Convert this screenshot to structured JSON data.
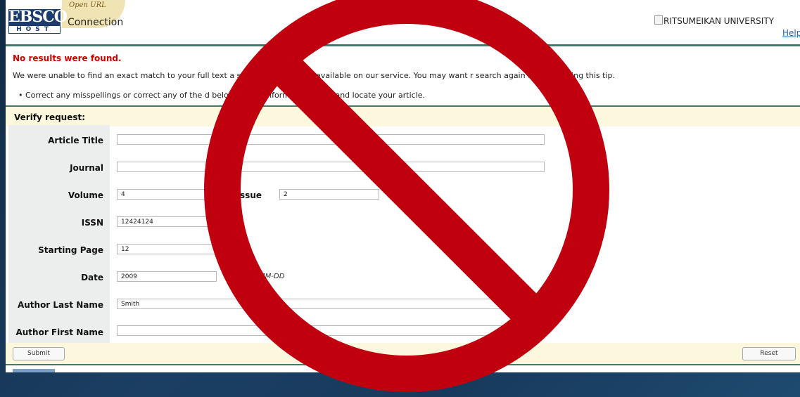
{
  "header": {
    "brand_top": "EBSCO",
    "brand_bottom": "HOST",
    "tagline": "Open URL",
    "product": "Connection",
    "institution_logo_alt": "RITSUMEIKAN UNIVERSITY",
    "help_link": "Help"
  },
  "messages": {
    "error": "No results were found.",
    "explanation": "We were unable to find an exact match to your full text a                   s p              article is not yet available on our service. You may want                 r search again after following this tip.",
    "tip": "Correct any misspellings or correct any of the d              below an                    the information to try and locate your article."
  },
  "form": {
    "title": "Verify request:",
    "fields": {
      "article_title": {
        "label": "Article Title",
        "value": ""
      },
      "journal": {
        "label": "Journal",
        "value": ""
      },
      "volume": {
        "label": "Volume",
        "value": "4"
      },
      "issue": {
        "label": "Issue",
        "value": "2"
      },
      "issn": {
        "label": "ISSN",
        "value": "12424124"
      },
      "starting_page": {
        "label": "Starting Page",
        "value": "12"
      },
      "date": {
        "label": "Date",
        "value": "2009",
        "hint": "le: YYYY-MM-DD"
      },
      "author_last": {
        "label": "Author Last Name",
        "value": "Smith"
      },
      "author_first": {
        "label": "Author First Name",
        "value": ""
      }
    },
    "submit_label": "Submit",
    "reset_label": "Reset"
  },
  "overlay": {
    "symbol": "prohibition-sign",
    "color": "#c0000f"
  }
}
